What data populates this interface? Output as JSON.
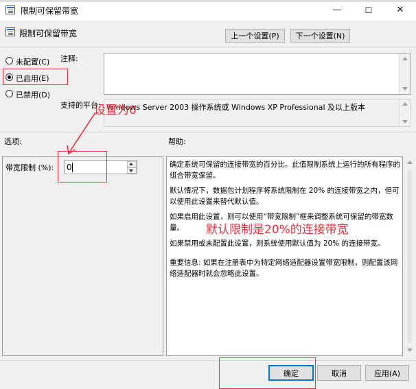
{
  "window": {
    "title": "限制可保留带宽",
    "minimize_glyph": "—",
    "maximize_glyph": "☐",
    "close_glyph": "✕"
  },
  "header": {
    "setting_name": "限制可保留带宽",
    "prev_label": "上一个设置(P)",
    "next_label": "下一个设置(N)"
  },
  "state": {
    "options": [
      {
        "label": "未配置(C)",
        "checked": false
      },
      {
        "label": "已启用(E)",
        "checked": true
      },
      {
        "label": "已禁用(D)",
        "checked": false
      }
    ]
  },
  "comment": {
    "label": "注释:",
    "value": ""
  },
  "supported": {
    "label": "支持的平台:",
    "value": "Windows Server 2003 操作系统或 Windows XP Professional 及以上版本"
  },
  "options_section": {
    "label": "选项:",
    "bandwidth_label": "带宽限制 (%):",
    "bandwidth_value": "0"
  },
  "help_section": {
    "label": "帮助:",
    "paragraphs": [
      "确定系统可保留的连接带宽的百分比。此值限制系统上运行的所有程序的组合带宽保留。",
      "默认情况下，数据包计划程序将系统限制在 20% 的连接带宽之内，但可以使用此设置来替代默认值。",
      "如果启用此设置，则可以使用“带宽限制”框来调整系统可保留的带宽数量。",
      "如果禁用或未配置此设置，则系统使用默认值为 20% 的连接带宽。",
      "重要信息: 如果在注册表中为特定网络适配器设置带宽限制，则配置该网络适配器时就会忽略此设置。"
    ]
  },
  "annotations": {
    "set_to_zero": "设置为0",
    "default_limit": "默认限制是20%的连接带宽"
  },
  "footer": {
    "ok_label": "确定",
    "cancel_label": "取消",
    "apply_label": "应用(A)"
  },
  "colors": {
    "annotation_red": "#e3333f",
    "focus_blue": "#0078d7"
  }
}
